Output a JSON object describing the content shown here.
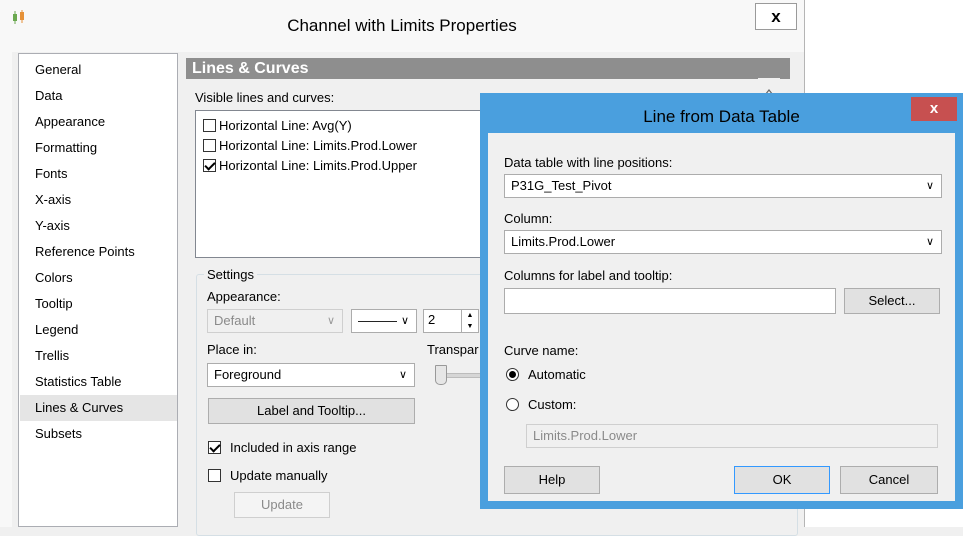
{
  "main_window": {
    "title": "Channel with Limits Properties",
    "close_label": "x"
  },
  "nav": {
    "items": [
      {
        "label": "General"
      },
      {
        "label": "Data"
      },
      {
        "label": "Appearance"
      },
      {
        "label": "Formatting"
      },
      {
        "label": "Fonts"
      },
      {
        "label": "X-axis"
      },
      {
        "label": "Y-axis"
      },
      {
        "label": "Reference Points"
      },
      {
        "label": "Colors"
      },
      {
        "label": "Tooltip"
      },
      {
        "label": "Legend"
      },
      {
        "label": "Trellis"
      },
      {
        "label": "Statistics Table"
      },
      {
        "label": "Lines & Curves",
        "selected": true
      },
      {
        "label": "Subsets"
      }
    ]
  },
  "panel": {
    "header": "Lines & Curves",
    "visible_label": "Visible lines and curves:",
    "lines": [
      {
        "label": "Horizontal Line: Avg(Y)",
        "checked": false
      },
      {
        "label": "Horizontal Line: Limits.Prod.Lower",
        "checked": false
      },
      {
        "label": "Horizontal Line: Limits.Prod.Upper",
        "checked": true
      }
    ],
    "settings": {
      "group_label": "Settings",
      "appearance_label": "Appearance:",
      "appearance_value": "Default",
      "line_style_value": "———",
      "width_value": "2",
      "place_in_label": "Place in:",
      "place_in_value": "Foreground",
      "transparency_label": "Transpar",
      "label_tooltip_button": "Label and Tooltip...",
      "included_label": "Included in axis range",
      "included_checked": true,
      "update_manually_label": "Update manually",
      "update_manually_checked": false,
      "update_button": "Update"
    }
  },
  "dialog": {
    "title": "Line from Data Table",
    "close_label": "x",
    "data_table_label": "Data table with line positions:",
    "data_table_value": "P31G_Test_Pivot",
    "column_label": "Column:",
    "column_value": "Limits.Prod.Lower",
    "label_tooltip_label": "Columns for label and tooltip:",
    "label_tooltip_value": "",
    "select_button": "Select...",
    "curve_name_label": "Curve name:",
    "automatic_label": "Automatic",
    "custom_label": "Custom:",
    "selected_option": "Automatic",
    "custom_value": "Limits.Prod.Lower",
    "help_button": "Help",
    "ok_button": "OK",
    "cancel_button": "Cancel"
  }
}
